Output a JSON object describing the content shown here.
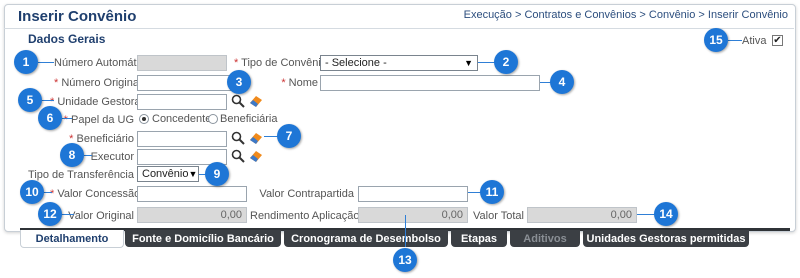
{
  "header": {
    "title": "Inserir Convênio",
    "breadcrumb": "Execução > Contratos e Convênios > Convênio > Inserir Convênio"
  },
  "section": {
    "title": "Dados Gerais"
  },
  "fields": {
    "numero_automatico": {
      "label": "Número Automático",
      "value": ""
    },
    "tipo_convenio": {
      "req": "*",
      "label": "Tipo de Convênio",
      "selected": "- Selecione -"
    },
    "numero_original": {
      "req": "*",
      "label": "Número Original",
      "value": ""
    },
    "nome": {
      "req": "*",
      "label": "Nome",
      "value": ""
    },
    "unidade_gestora": {
      "req": "*",
      "label": "Unidade Gestora",
      "value": ""
    },
    "papel_ug": {
      "req": "*",
      "label": "Papel da UG",
      "options": [
        "Concedente",
        "Beneficiária"
      ],
      "selected": "Concedente"
    },
    "beneficiario": {
      "req": "*",
      "label": "Beneficiário",
      "value": ""
    },
    "executor": {
      "label": "Executor",
      "value": ""
    },
    "tipo_transferencia": {
      "label": "Tipo de Transferência",
      "selected": "Convênio"
    },
    "valor_concessao": {
      "req": "*",
      "label": "Valor Concessão",
      "value": ""
    },
    "valor_contrapartida": {
      "label": "Valor Contrapartida",
      "value": ""
    },
    "valor_original": {
      "label": "Valor Original",
      "value": "0,00"
    },
    "rendimento_aplicacao": {
      "label": "Rendimento Aplicação",
      "value": "0,00"
    },
    "valor_total": {
      "label": "Valor Total",
      "value": "0,00"
    },
    "ativa": {
      "label": "Ativa",
      "checked": "✔"
    }
  },
  "tabs": [
    {
      "label": "Detalhamento",
      "state": "active"
    },
    {
      "label": "Fonte e Domicílio Bancário",
      "state": "normal"
    },
    {
      "label": "Cronograma de Desembolso",
      "state": "normal"
    },
    {
      "label": "Etapas",
      "state": "normal"
    },
    {
      "label": "Aditivos",
      "state": "disabled"
    },
    {
      "label": "Unidades Gestoras permitidas",
      "state": "normal"
    }
  ],
  "badges": [
    "1",
    "2",
    "3",
    "4",
    "5",
    "6",
    "7",
    "8",
    "9",
    "10",
    "11",
    "12",
    "13",
    "14",
    "15"
  ],
  "colors": {
    "accent": "#1e76d6",
    "title": "#1f3f6e",
    "tab_dark": "#3b3f44"
  },
  "icons": {
    "search": "magnifier-icon",
    "eraser": "eraser-icon"
  }
}
